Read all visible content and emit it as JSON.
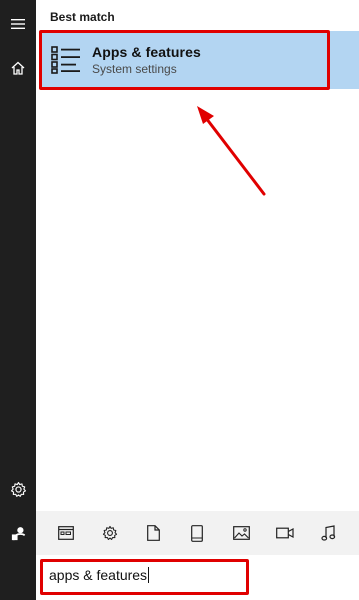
{
  "sidebar": {
    "items": [
      {
        "name": "hamburger-menu",
        "icon": "hamburger-icon"
      },
      {
        "name": "home",
        "icon": "home-icon"
      },
      {
        "name": "settings",
        "icon": "gear-icon"
      },
      {
        "name": "user",
        "icon": "user-icon"
      }
    ]
  },
  "results": {
    "section_label": "Best match",
    "best_match": {
      "title": "Apps & features",
      "subtitle": "System settings",
      "icon": "apps-list-icon"
    }
  },
  "filters": [
    {
      "icon": "apps-filter-icon"
    },
    {
      "icon": "settings-filter-icon"
    },
    {
      "icon": "documents-filter-icon"
    },
    {
      "icon": "device-filter-icon"
    },
    {
      "icon": "photos-filter-icon"
    },
    {
      "icon": "videos-filter-icon"
    },
    {
      "icon": "music-filter-icon"
    }
  ],
  "search": {
    "value": "apps & features"
  },
  "colors": {
    "rail": "#1f1f1f",
    "selection": "#b3d5f2",
    "highlight": "#e00000",
    "filters_bg": "#f2f2f2"
  }
}
